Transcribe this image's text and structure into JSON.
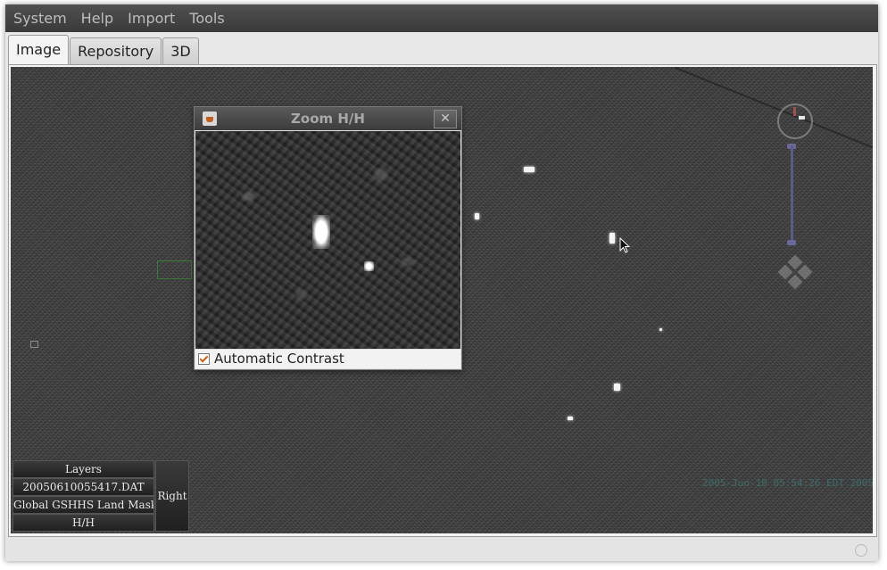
{
  "menu": [
    "System",
    "Help",
    "Import",
    "Tools"
  ],
  "tabs": [
    "Image",
    "Repository",
    "3D"
  ],
  "active_tab": "Image",
  "zoom_window": {
    "title": "Zoom H/H",
    "close_glyph": "✕",
    "checkbox_label": "Automatic Contrast",
    "checkbox_checked": true
  },
  "layers": {
    "header": "Layers",
    "items": [
      "20050610055417.DAT",
      "Global GSHHS Land Mask",
      "H/H"
    ],
    "side_button": "Right"
  },
  "timestamp": "2005-Jun-10 05:54:26 EDT 2005",
  "icons": {
    "close": "close-icon",
    "java": "java-app-icon",
    "compass": "compass-icon",
    "pan": "pan-control-icon",
    "cursor": "mouse-pointer-icon",
    "status": "status-circle-icon"
  },
  "colors": {
    "menubar": "#464646",
    "checkmark": "#d06010",
    "overlay_text": "#3d6b6b"
  }
}
